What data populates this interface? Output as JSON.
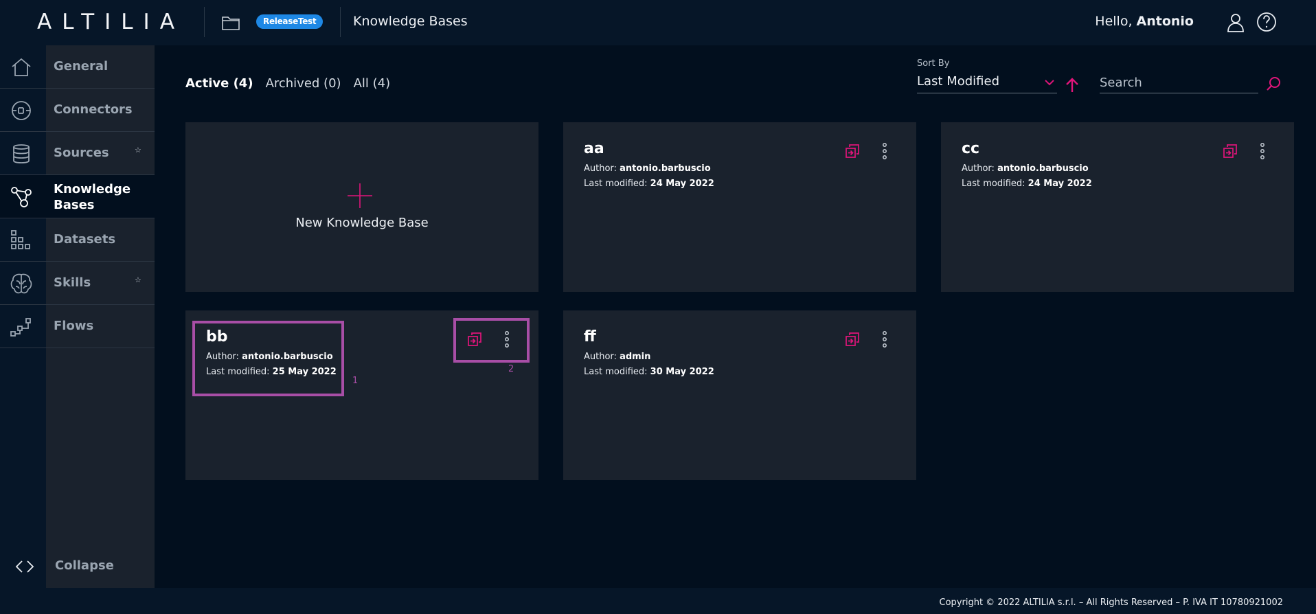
{
  "header": {
    "logo": "ALTILIA",
    "env_badge": "ReleaseTest",
    "title": "Knowledge Bases",
    "greeting_prefix": "Hello,",
    "user_name": "Antonio"
  },
  "sidebar": {
    "items": [
      {
        "label": "General",
        "icon": "home-icon"
      },
      {
        "label": "Connectors",
        "icon": "plug-icon"
      },
      {
        "label": "Sources",
        "icon": "database-icon",
        "star": "☆"
      },
      {
        "label": "Knowledge Bases",
        "icon": "graph-icon",
        "active": true
      },
      {
        "label": "Datasets",
        "icon": "dataset-grid-icon"
      },
      {
        "label": "Skills",
        "icon": "brain-icon",
        "star": "☆"
      },
      {
        "label": "Flows",
        "icon": "flow-icon"
      }
    ],
    "collapse_label": "Collapse"
  },
  "toolbar": {
    "tabs": [
      "Active (4)",
      "Archived (0)",
      "All (4)"
    ],
    "sort_label": "Sort By",
    "sort_value": "Last Modified",
    "search_placeholder": "Search"
  },
  "new_card_label": "New Knowledge Base",
  "kb_author_label": "Author:",
  "kb_modified_label": "Last modified:",
  "knowledge_bases": [
    {
      "name": "aa",
      "author": "antonio.barbuscio",
      "modified": "24 May 2022"
    },
    {
      "name": "cc",
      "author": "antonio.barbuscio",
      "modified": "24 May 2022"
    },
    {
      "name": "bb",
      "author": "antonio.barbuscio",
      "modified": "25 May 2022"
    },
    {
      "name": "ff",
      "author": "admin",
      "modified": "30 May 2022"
    }
  ],
  "annotations": [
    "1",
    "2"
  ],
  "footer": {
    "copyright": "Copyright © 2022 ALTILIA s.r.l. – All Rights Reserved – P. IVA IT 10780921002"
  },
  "colors": {
    "accent": "#e0157a",
    "badge": "#1e88e5",
    "annotation": "#a84ea6",
    "background": "#020f1e",
    "card": "#1a222d"
  }
}
